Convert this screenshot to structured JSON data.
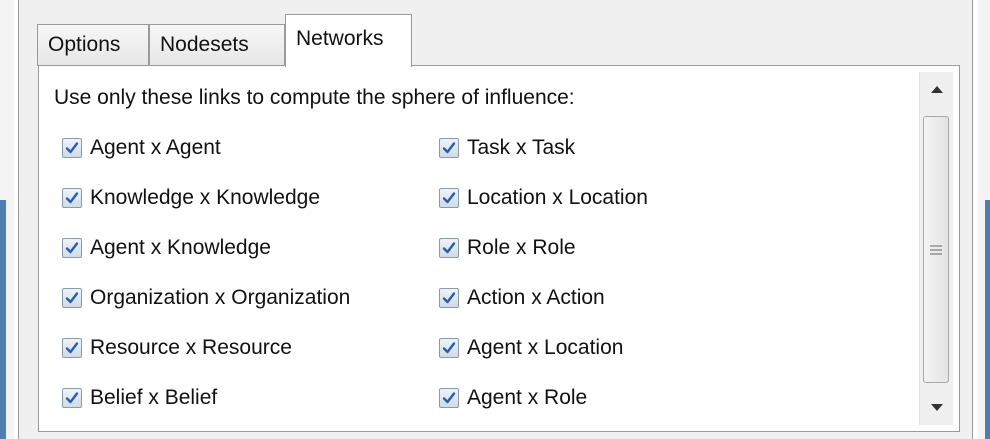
{
  "tabs": [
    {
      "label": "Options",
      "active": false
    },
    {
      "label": "Nodesets",
      "active": false
    },
    {
      "label": "Networks",
      "active": true
    }
  ],
  "instruction": "Use only these links to compute the sphere of influence:",
  "checkboxes": {
    "left": [
      {
        "label": "Agent x Agent",
        "checked": true
      },
      {
        "label": "Knowledge x Knowledge",
        "checked": true
      },
      {
        "label": "Agent x Knowledge",
        "checked": true
      },
      {
        "label": "Organization x Organization",
        "checked": true
      },
      {
        "label": "Resource x Resource",
        "checked": true
      },
      {
        "label": "Belief x Belief",
        "checked": true
      }
    ],
    "right": [
      {
        "label": "Task x Task",
        "checked": true
      },
      {
        "label": "Location x Location",
        "checked": true
      },
      {
        "label": "Role x Role",
        "checked": true
      },
      {
        "label": "Action x Action",
        "checked": true
      },
      {
        "label": "Agent x Location",
        "checked": true
      },
      {
        "label": "Agent x Role",
        "checked": true
      }
    ]
  },
  "icons": {
    "check": "checkmark-icon",
    "scroll_up": "arrow-up-icon",
    "scroll_down": "arrow-down-icon",
    "thumb_grip": "grip-icon"
  },
  "colors": {
    "checkmark": "#2a5db0",
    "window_accent": "#4f7fb0"
  }
}
